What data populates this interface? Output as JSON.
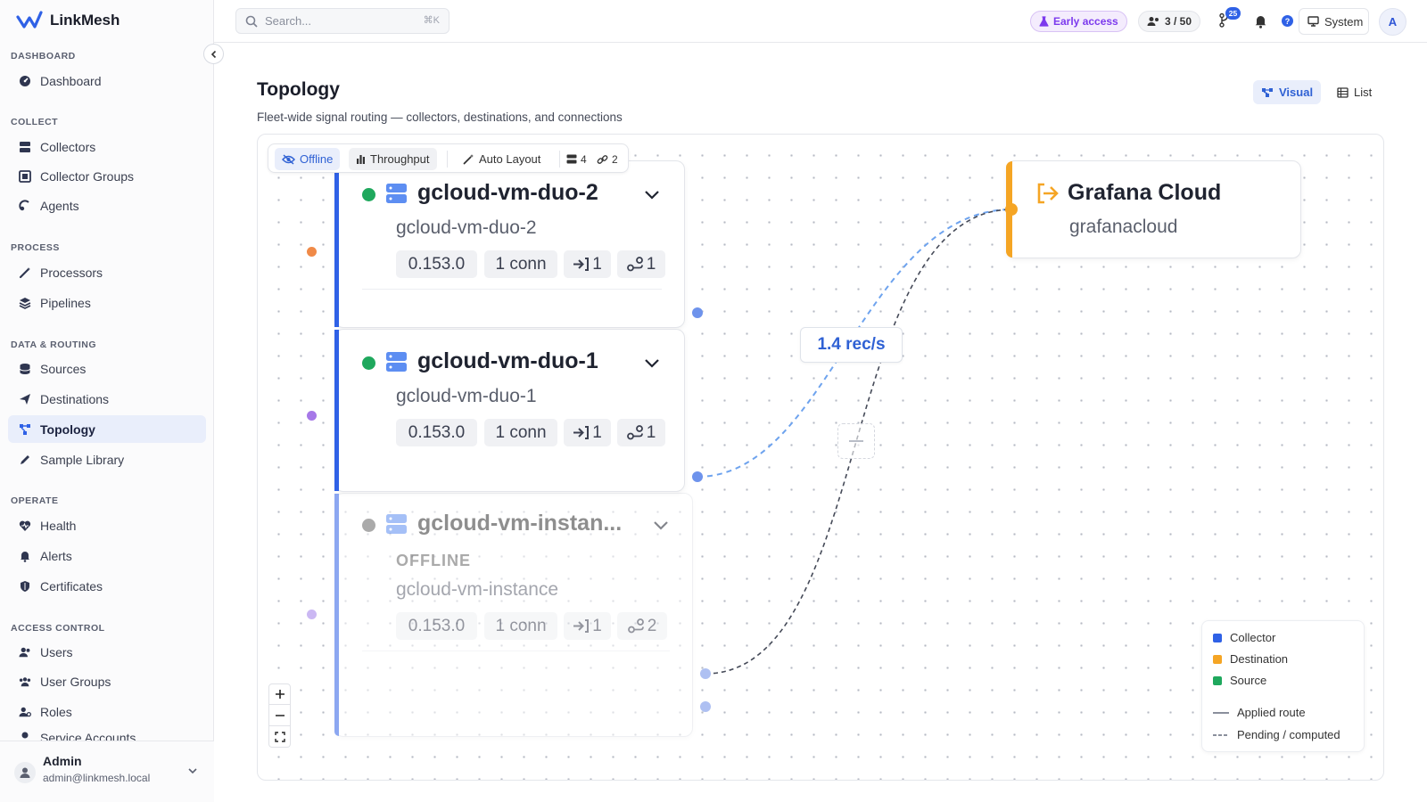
{
  "app": {
    "name": "LinkMesh"
  },
  "sidebar": {
    "sections": [
      {
        "label": "DASHBOARD",
        "items": [
          {
            "label": "Dashboard",
            "icon": "gauge-icon"
          }
        ]
      },
      {
        "label": "COLLECT",
        "items": [
          {
            "label": "Collectors",
            "icon": "server-icon"
          },
          {
            "label": "Collector Groups",
            "icon": "group-icon"
          },
          {
            "label": "Agents",
            "icon": "agent-icon"
          }
        ]
      },
      {
        "label": "PROCESS",
        "items": [
          {
            "label": "Processors",
            "icon": "wand-icon"
          },
          {
            "label": "Pipelines",
            "icon": "layers-icon"
          }
        ]
      },
      {
        "label": "DATA & ROUTING",
        "items": [
          {
            "label": "Sources",
            "icon": "database-icon"
          },
          {
            "label": "Destinations",
            "icon": "send-icon"
          },
          {
            "label": "Topology",
            "icon": "topology-icon",
            "active": true
          },
          {
            "label": "Sample Library",
            "icon": "pen-icon"
          }
        ]
      },
      {
        "label": "OPERATE",
        "items": [
          {
            "label": "Health",
            "icon": "heart-pulse-icon"
          },
          {
            "label": "Alerts",
            "icon": "bell-icon"
          },
          {
            "label": "Certificates",
            "icon": "shield-icon"
          }
        ]
      },
      {
        "label": "ACCESS CONTROL",
        "items": [
          {
            "label": "Users",
            "icon": "users-icon"
          },
          {
            "label": "User Groups",
            "icon": "user-groups-icon"
          },
          {
            "label": "Roles",
            "icon": "roles-icon"
          },
          {
            "label": "Service Accounts",
            "icon": "service-account-icon"
          }
        ]
      }
    ],
    "user": {
      "name": "Admin",
      "email": "admin@linkmesh.local"
    }
  },
  "topbar": {
    "search_placeholder": "Search...",
    "search_shortcut": "⌘K",
    "early_access": "Early access",
    "seats": "3 / 50",
    "notif_badge": "25",
    "system": "System",
    "avatar": "A"
  },
  "page": {
    "title": "Topology",
    "subtitle": "Fleet-wide signal routing — collectors, destinations, and connections",
    "view_visual": "Visual",
    "view_list": "List"
  },
  "toolbar": {
    "offline": "Offline",
    "throughput": "Throughput",
    "auto_layout": "Auto Layout",
    "collector_count": "4",
    "link_count": "2"
  },
  "nodes": [
    {
      "title": "gcloud-vm-duo-2",
      "subtitle": "gcloud-vm-duo-2",
      "status": "online",
      "version": "0.153.0",
      "conn": "1 conn",
      "in": "1",
      "routes": "1"
    },
    {
      "title": "gcloud-vm-duo-1",
      "subtitle": "gcloud-vm-duo-1",
      "status": "online",
      "version": "0.153.0",
      "conn": "1 conn",
      "in": "1",
      "routes": "1"
    },
    {
      "title": "gcloud-vm-instan...",
      "offline_label": "OFFLINE",
      "subtitle": "gcloud-vm-instance",
      "status": "offline",
      "version": "0.153.0",
      "conn": "1 conn",
      "in": "1",
      "routes": "2"
    }
  ],
  "destination": {
    "title": "Grafana Cloud",
    "subtitle": "grafanacloud"
  },
  "edge_label": "1.4 rec/s",
  "legend": {
    "collector": "Collector",
    "destination": "Destination",
    "source": "Source",
    "applied": "Applied route",
    "pending": "Pending / computed"
  },
  "colors": {
    "collector": "#2f61e6",
    "destination": "#f5a524",
    "source": "#1fa85d",
    "accent": "#2f61d4"
  }
}
